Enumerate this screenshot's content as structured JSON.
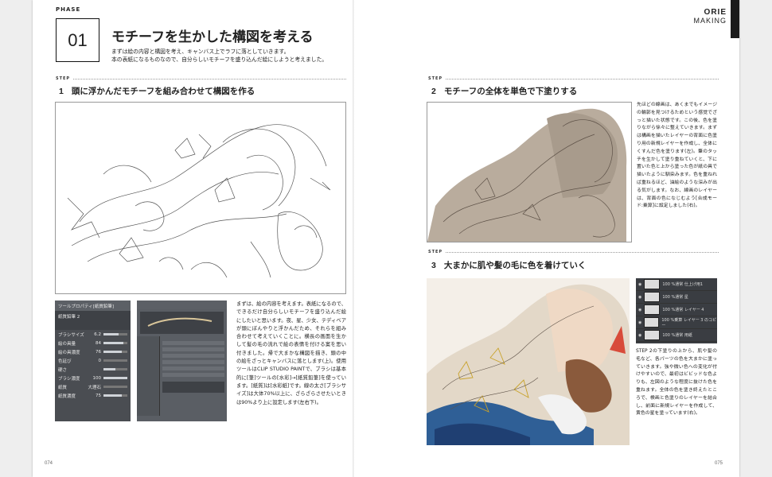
{
  "header": {
    "phase_label": "PHASE",
    "phase_number": "01",
    "title": "モチーフを生かした構図を考える",
    "intro_lines": [
      "まずは絵の内容と構図を考え、キャンバス上でラフに落としていきます。",
      "本の表紙になるものなので、自分らしいモチーフを盛り込んだ絵にしようと考えました。"
    ],
    "brand_line1": "ORIE",
    "brand_line2": "MAKING"
  },
  "steps": [
    {
      "tag": "STEP",
      "number": "1",
      "title": "頭に浮かんだモチーフを組み合わせて構図を作る"
    },
    {
      "tag": "STEP",
      "number": "2",
      "title": "モチーフの全体を単色で下塗りする"
    },
    {
      "tag": "STEP",
      "number": "3",
      "title": "大まかに肌や髪の毛に色を着けていく"
    }
  ],
  "step1_text": "まずは、絵の内容を考えます。表紙になるので、できるだけ自分らしいモチーフを盛り込んだ絵にしたいと思います。夜、星、少女、テディベアが頭にぼんやりと浮かんだため、それらを組み合わせて考えていくことに。横長の画面を生かして髪の毛の流れで絵の表情を付ける案を思い付きました。帰で大まかな構図を描き、頭の中の絵をざっとキャンバスに落とします(上)。使用ツールはCLIP STUDIO PAINTで、ブラシは基本的に[筆]ツールの[水彩]→[紙質鉛筆]を使っています。[紙質]は[水彩紙]です。線の太さ[ブラシサイズ]は大体70%以上に、ざらざらさせたいときは90%より上に設定します(左右下)。",
  "step2_text": "先ほどの線画は、あくまでもイメージの輪郭を見つけるためという感覚でざっと描いた状態です。この後、色を塗りながら徐々に整えていきます。まずは構画を描いたレイヤーの背面に色塗り用の新規レイヤーを作成し、全体にくすんだ色を塗ります(左)。筆のタッチを生かして塗り重ねていくと、下に置いた色と上から塗った色が紙の具で描いたように馴染みます。色を重ねれば重ねるほど、油絵のような深みが出る気がします。なお、線画のレイヤーは、背面の色になじむよう[合成モード:乗算]に設定しました(右)。",
  "step3_text": "STEP 2の下塗りの上から、肌や髪の毛など、各パーツの色を大まかに塗っていきます。強や微い色への変化が付けやすいので、最初はビビッドな色よりも、左図のような程度に抜けた色を重ねます。全体の色を塗き終えたところで、検画と色塗りのレイヤーを結合し、前面に新規レイヤーを作成して、黄色の星を塗っています(右)。",
  "tool_panel_1": {
    "title": "ツールプロパティ[紙質鉛筆]",
    "brush_name": "紙質鉛筆 2",
    "rows": [
      {
        "label": "ブラシサイズ",
        "value": "6.2",
        "level": 0.62
      },
      {
        "label": "絵の具量",
        "value": "84",
        "level": 0.84
      },
      {
        "label": "絵の具濃度",
        "value": "76",
        "level": 0.76
      },
      {
        "label": "色延び",
        "value": "0",
        "level": 0.0
      },
      {
        "label": "硬さ",
        "value": "",
        "level": 0.5
      },
      {
        "label": "ブラシ濃度",
        "value": "100",
        "level": 1.0
      },
      {
        "label": "紙質",
        "value": "大理石",
        "level": 0.0
      },
      {
        "label": "紙質濃度",
        "value": "75",
        "level": 0.75
      }
    ]
  },
  "layer_panel": {
    "layers": [
      {
        "label": "100 %通常 仕上げ用1"
      },
      {
        "label": "100 %通常 星"
      },
      {
        "label": "100 %通常 レイヤー 4"
      },
      {
        "label": "100 %乗算 レイヤー 3 のコピー"
      },
      {
        "label": "100 %通常 用紙"
      }
    ]
  },
  "folios": {
    "left": "074",
    "right": "075"
  },
  "colors": {
    "sketch_bg": "#ffffff",
    "underpaint": "#b9ac9d",
    "accent": "#1a1a1a"
  }
}
